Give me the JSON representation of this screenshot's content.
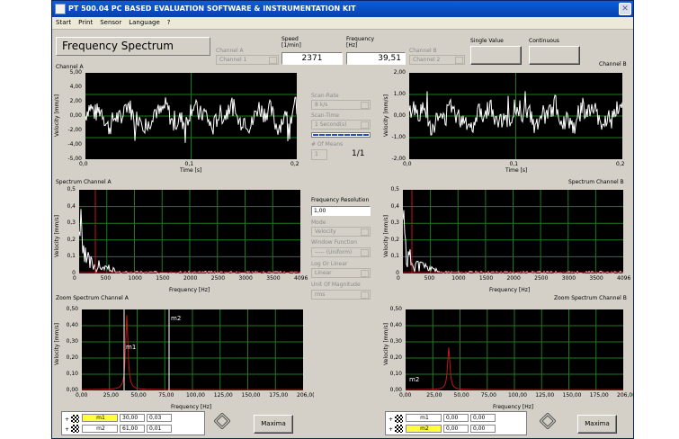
{
  "window": {
    "title": "PT 500.04 PC BASED EVALUATION SOFTWARE & INSTRUMENTATION KIT",
    "close_glyph": "✕"
  },
  "menu": [
    "Start",
    "Print",
    "Sensor",
    "Language",
    "?"
  ],
  "top": {
    "panel_title": "Frequency Spectrum",
    "channel_a_label": "Channel A",
    "channel_a_value": "Channel 1",
    "speed_label_1": "Speed",
    "speed_label_2": "[1/min]",
    "speed_value": "2371",
    "frequency_label_1": "Frequency",
    "frequency_label_2": "[Hz]",
    "frequency_value": "39,51",
    "channel_b_label": "Channel B",
    "channel_b_value": "Channel 2",
    "single_value_label": "Single Value",
    "continuous_label": "Continuous"
  },
  "sections": {
    "channel_a": "Channel A",
    "channel_b": "Channel B",
    "spectrum_a": "Spectrum Channel  A",
    "spectrum_b": "Spectrum Channel  B",
    "zoom_a": "Zoom Spectrum Channel A",
    "zoom_b": "Zoom Spectrum Channel B"
  },
  "time_plot_a": {
    "ylabel": "Velocity [mm/s]",
    "xlabel": "Time [s]",
    "yticks": [
      "5,00",
      "4,00",
      "2,00",
      "0,00",
      "-2,00",
      "-4,00",
      "-5,00"
    ],
    "xticks": [
      "0,0",
      "0,1",
      "0,2"
    ]
  },
  "time_plot_b": {
    "ylabel": "Velocity [mm/s]",
    "xlabel": "Time [s]",
    "yticks": [
      "2,00",
      "1,00",
      "0,00",
      "-1,00",
      "-2,00"
    ],
    "xticks": [
      "0,0",
      "0,1",
      "0,2"
    ]
  },
  "spec_plot_a": {
    "ylabel": "Velocity [mm/s]",
    "xlabel": "Frequency [Hz]",
    "yticks": [
      "0,5",
      "0,4",
      "0,3",
      "0,2",
      "0,1",
      "0"
    ],
    "xticks": [
      "0",
      "500",
      "1000",
      "1500",
      "2000",
      "2500",
      "3000",
      "3500",
      "4096"
    ]
  },
  "spec_plot_b": {
    "ylabel": "Velocity [mm/s]",
    "xlabel": "Frequency [Hz]",
    "yticks": [
      "0,5",
      "0,4",
      "0,3",
      "0,2",
      "0,1",
      "0"
    ],
    "xticks": [
      "0",
      "500",
      "1000",
      "1500",
      "2000",
      "2500",
      "3000",
      "3500",
      "4096"
    ]
  },
  "zoom_plot_a": {
    "ylabel": "Velocity [mm/s]",
    "xlabel": "Frequency [Hz]",
    "yticks": [
      "0,50",
      "0,40",
      "0,30",
      "0,20",
      "0,10",
      "0,00"
    ],
    "xticks": [
      "0,00",
      "25,00",
      "50,00",
      "75,00",
      "100,00",
      "125,00",
      "150,00",
      "175,00",
      "206,0("
    ],
    "marker1": "m1",
    "marker2": "m2"
  },
  "zoom_plot_b": {
    "ylabel": "Velocity [mm/s]",
    "xlabel": "Frequency [Hz]",
    "yticks": [
      "0,50",
      "0,40",
      "0,30",
      "0,20",
      "0,10",
      "0,00"
    ],
    "xticks": [
      "0,00",
      "25,00",
      "50,00",
      "75,00",
      "100,00",
      "125,00",
      "150,00",
      "175,00",
      "206,0("
    ],
    "marker2": "m2"
  },
  "middle": {
    "scan_rate_label": "Scan-Rate",
    "scan_rate_value": "8 k/s",
    "scan_time_label": "Scan-Time",
    "scan_time_value": "1 Second(s)",
    "means_label": "# Of Means",
    "means_value": "1",
    "means_ratio": "1/1",
    "freq_res_label": "Frequency Resolution",
    "freq_res_value": "1,00",
    "mode_label": "Mode",
    "mode_value": "Velocity",
    "window_label": "Window Function",
    "window_value": "----- (Uniform)",
    "log_label": "Log Or Linear",
    "log_value": "Linear",
    "unit_label": "Unit Of Magnitude",
    "unit_value": "rms"
  },
  "cursors_a": [
    {
      "name": "m1",
      "x": "30,00",
      "y": "0,03"
    },
    {
      "name": "m2",
      "x": "61,00",
      "y": "0,01"
    }
  ],
  "cursors_b": [
    {
      "name": "m1",
      "x": "0,00",
      "y": "0,00"
    },
    {
      "name": "m2",
      "x": "0,00",
      "y": "0,00"
    }
  ],
  "maxima_label": "Maxima",
  "colors": {
    "plot_bg": "#000000",
    "grid": "#1f7a1f",
    "trace_time": "#ffffff",
    "trace_spec": "#ffffff",
    "trace_zoom": "#c01818",
    "highlight": "#ffff40"
  }
}
